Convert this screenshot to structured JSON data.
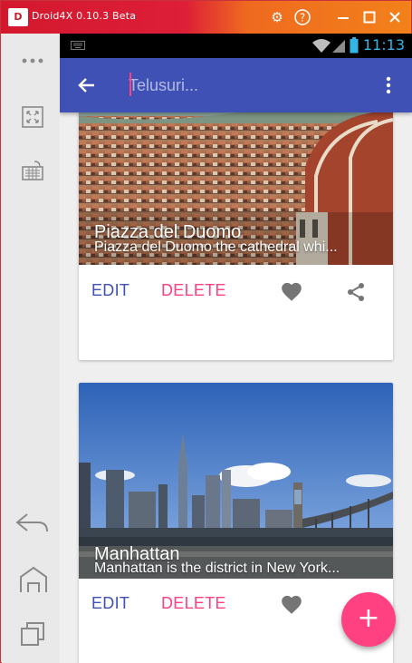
{
  "window": {
    "title": "Droid4X 0.10.3 Beta",
    "logo_text": "D",
    "controls": [
      "gear-icon",
      "help-icon",
      "minimize-icon",
      "maximize-icon",
      "close-icon"
    ]
  },
  "status_bar": {
    "time": "11:13"
  },
  "app_bar": {
    "search_placeholder": "Telusuri...",
    "back_icon": "arrow-back-icon",
    "menu_icon": "more-vert-icon"
  },
  "cards": [
    {
      "title": "Piazza del Duomo",
      "description": "Piazza del Duomo the cathedral whi...",
      "edit_label": "EDIT",
      "delete_label": "DELETE"
    },
    {
      "title": "Manhattan",
      "description": "Manhattan is the district in New York...",
      "edit_label": "EDIT",
      "delete_label": "DELETE"
    }
  ],
  "fab": {
    "label": "+"
  },
  "colors": {
    "primary": "#3f51b5",
    "accent": "#ff4081",
    "status_clock": "#33b5e5"
  }
}
